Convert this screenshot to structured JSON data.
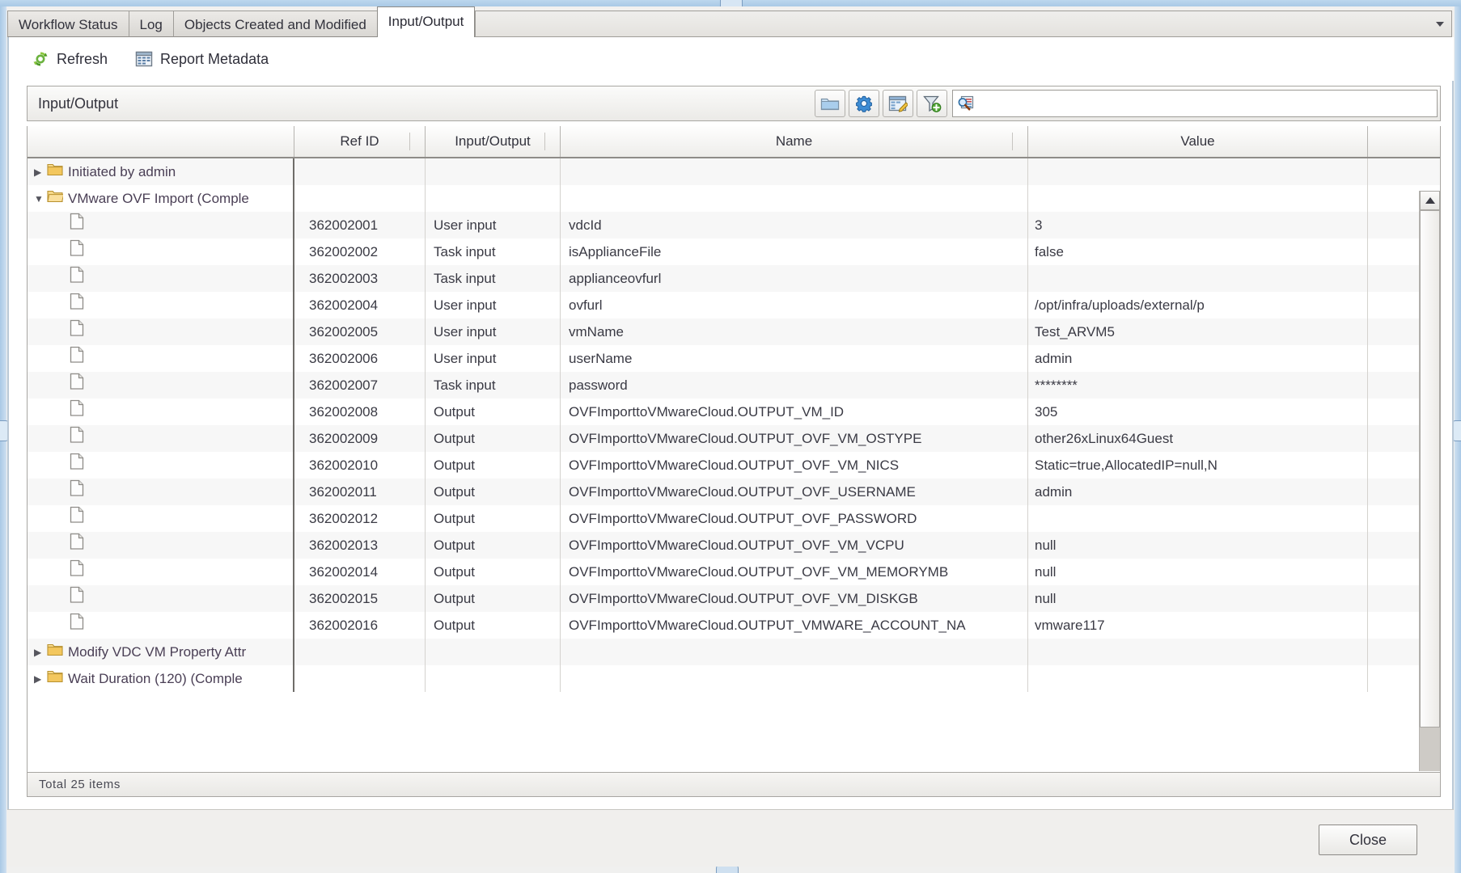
{
  "window": {
    "tabs": [
      {
        "label": "Workflow Status",
        "active": false
      },
      {
        "label": "Log",
        "active": false
      },
      {
        "label": "Objects Created and Modified",
        "active": false
      },
      {
        "label": "Input/Output",
        "active": true
      }
    ]
  },
  "toolbar": {
    "refresh_label": "Refresh",
    "report_metadata_label": "Report Metadata",
    "refresh_icon": "refresh-icon",
    "report_icon": "report-metadata-icon"
  },
  "gridbar": {
    "title": "Input/Output",
    "buttons": [
      {
        "name": "folder-button",
        "icon": "folder-icon"
      },
      {
        "name": "settings-button",
        "icon": "gear-icon"
      },
      {
        "name": "edit-report-button",
        "icon": "report-edit-icon"
      },
      {
        "name": "add-filter-button",
        "icon": "filter-add-icon"
      }
    ],
    "search": {
      "value": "",
      "placeholder": "",
      "icon": "search-icon"
    }
  },
  "table": {
    "columns": [
      {
        "key": "tree",
        "label": ""
      },
      {
        "key": "ref_id",
        "label": "Ref ID"
      },
      {
        "key": "io",
        "label": "Input/Output"
      },
      {
        "key": "name",
        "label": "Name"
      },
      {
        "key": "value",
        "label": "Value"
      }
    ],
    "rows": [
      {
        "type": "group",
        "expanded": false,
        "label": "Initiated by admin",
        "ref_id": "",
        "io": "",
        "name": "",
        "value": ""
      },
      {
        "type": "group",
        "expanded": true,
        "label": "VMware OVF Import (Comple",
        "ref_id": "",
        "io": "",
        "name": "",
        "value": ""
      },
      {
        "type": "leaf",
        "ref_id": "362002001",
        "io": "User input",
        "name": "vdcId",
        "value": "3"
      },
      {
        "type": "leaf",
        "ref_id": "362002002",
        "io": "Task input",
        "name": "isApplianceFile",
        "value": "false"
      },
      {
        "type": "leaf",
        "ref_id": "362002003",
        "io": "Task input",
        "name": "applianceovfurl",
        "value": ""
      },
      {
        "type": "leaf",
        "ref_id": "362002004",
        "io": "User input",
        "name": "ovfurl",
        "value": "/opt/infra/uploads/external/p"
      },
      {
        "type": "leaf",
        "ref_id": "362002005",
        "io": "User input",
        "name": "vmName",
        "value": "Test_ARVM5"
      },
      {
        "type": "leaf",
        "ref_id": "362002006",
        "io": "User input",
        "name": "userName",
        "value": "admin"
      },
      {
        "type": "leaf",
        "ref_id": "362002007",
        "io": "Task input",
        "name": "password",
        "value": "********"
      },
      {
        "type": "leaf",
        "ref_id": "362002008",
        "io": "Output",
        "name": "OVFImporttoVMwareCloud.OUTPUT_VM_ID",
        "value": "305"
      },
      {
        "type": "leaf",
        "ref_id": "362002009",
        "io": "Output",
        "name": "OVFImporttoVMwareCloud.OUTPUT_OVF_VM_OSTYPE",
        "value": "other26xLinux64Guest"
      },
      {
        "type": "leaf",
        "ref_id": "362002010",
        "io": "Output",
        "name": "OVFImporttoVMwareCloud.OUTPUT_OVF_VM_NICS",
        "value": "Static=true,AllocatedIP=null,N"
      },
      {
        "type": "leaf",
        "ref_id": "362002011",
        "io": "Output",
        "name": "OVFImporttoVMwareCloud.OUTPUT_OVF_USERNAME",
        "value": "admin"
      },
      {
        "type": "leaf",
        "ref_id": "362002012",
        "io": "Output",
        "name": "OVFImporttoVMwareCloud.OUTPUT_OVF_PASSWORD",
        "value": ""
      },
      {
        "type": "leaf",
        "ref_id": "362002013",
        "io": "Output",
        "name": "OVFImporttoVMwareCloud.OUTPUT_OVF_VM_VCPU",
        "value": "null"
      },
      {
        "type": "leaf",
        "ref_id": "362002014",
        "io": "Output",
        "name": "OVFImporttoVMwareCloud.OUTPUT_OVF_VM_MEMORYMB",
        "value": "null"
      },
      {
        "type": "leaf",
        "ref_id": "362002015",
        "io": "Output",
        "name": "OVFImporttoVMwareCloud.OUTPUT_OVF_VM_DISKGB",
        "value": "null"
      },
      {
        "type": "leaf",
        "ref_id": "362002016",
        "io": "Output",
        "name": "OVFImporttoVMwareCloud.OUTPUT_VMWARE_ACCOUNT_NA",
        "value": "vmware117"
      },
      {
        "type": "group",
        "expanded": false,
        "label": "Modify VDC VM Property Attr",
        "ref_id": "",
        "io": "",
        "name": "",
        "value": ""
      },
      {
        "type": "group",
        "expanded": false,
        "label": "Wait Duration (120) (Comple",
        "ref_id": "",
        "io": "",
        "name": "",
        "value": ""
      }
    ]
  },
  "statusbar": {
    "total_label": "Total 25 items"
  },
  "footer": {
    "close_label": "Close"
  },
  "colors": {
    "accent_blue": "#a9c9e6",
    "folder_yellow": "#f2c75c",
    "refresh_green": "#5fae3a",
    "text": "#33333d"
  }
}
